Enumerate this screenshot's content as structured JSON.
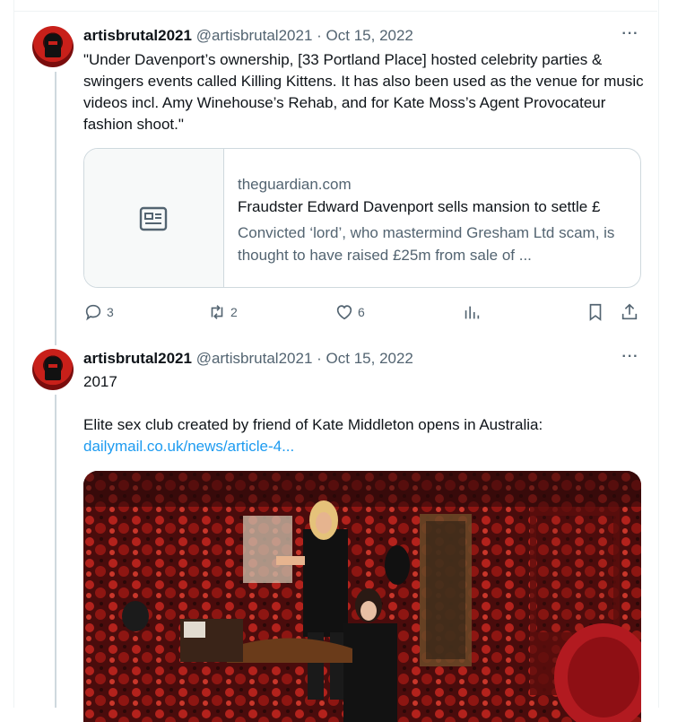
{
  "tweets": [
    {
      "display_name": "artisbrutal2021",
      "handle": "@artisbrutal2021",
      "separator": "·",
      "date": "Oct 15, 2022",
      "text": "\"Under Davenport’s ownership, [33 Portland Place] hosted celebrity parties & swingers events called Killing Kittens. It has also been used as the venue for music videos incl. Amy Winehouse’s Rehab, and for Kate Moss’s Agent Provocateur fashion shoot.\"",
      "card": {
        "domain": "theguardian.com",
        "title": "Fraudster Edward Davenport sells mansion to settle £",
        "description": "Convicted ‘lord’, who mastermind Gresham Ltd scam, is thought to have raised £25m from sale of ..."
      },
      "actions": {
        "reply_count": "3",
        "retweet_count": "2",
        "like_count": "6"
      }
    },
    {
      "display_name": "artisbrutal2021",
      "handle": "@artisbrutal2021",
      "separator": "·",
      "date": "Oct 15, 2022",
      "year_line": "2017",
      "text": "Elite sex club created by friend of Kate Middleton opens in Australia:",
      "link_text": "dailymail.co.uk/news/article-4..."
    }
  ],
  "icons": {
    "more": "more-dots-icon",
    "reply": "reply-icon",
    "retweet": "retweet-icon",
    "like": "heart-icon",
    "views": "views-chart-icon",
    "bookmark": "bookmark-icon",
    "share": "share-icon",
    "card_placeholder": "article-icon"
  },
  "colors": {
    "text_primary": "#0f1419",
    "text_secondary": "#536471",
    "link": "#1d9bf0",
    "border": "#cfd9de"
  }
}
